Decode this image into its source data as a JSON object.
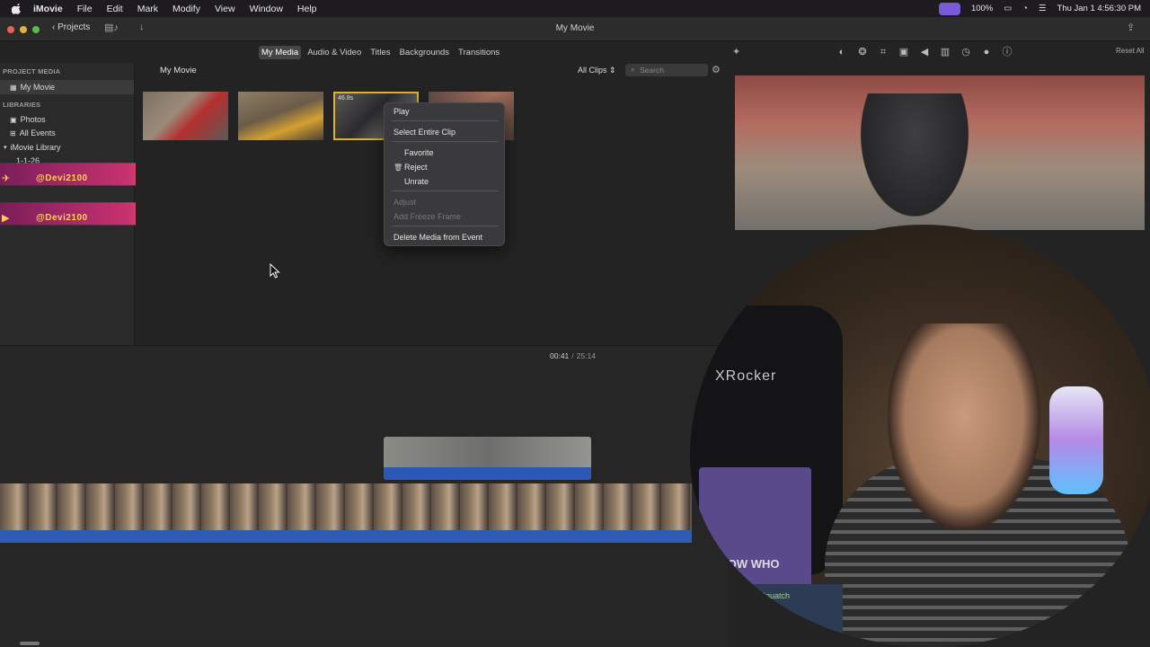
{
  "menubar": {
    "app_name": "iMovie",
    "items": [
      "File",
      "Edit",
      "Mark",
      "Modify",
      "View",
      "Window",
      "Help"
    ],
    "battery": "100%",
    "clock": "Thu Jan 1  4:56:30 PM"
  },
  "toolbar": {
    "projects_label": "Projects",
    "window_title": "My Movie"
  },
  "tabs": [
    "My Media",
    "Audio & Video",
    "Titles",
    "Backgrounds",
    "Transitions"
  ],
  "inspector": {
    "reset_all": "Reset All"
  },
  "sidebar": {
    "project_media_header": "PROJECT MEDIA",
    "project_item": "My Movie",
    "libraries_header": "LIBRARIES",
    "photos": "Photos",
    "all_events": "All Events",
    "library_name": "iMovie Library",
    "event_name": "1-1-26"
  },
  "browser": {
    "title": "My Movie",
    "filter": "All Clips",
    "search_placeholder": "Search",
    "selected_clip_duration": "46.8s"
  },
  "overlays": {
    "banner1_text": "@Devi2100",
    "banner2_text": "@Devi2100"
  },
  "context_menu": {
    "play": "Play",
    "select_entire_clip": "Select Entire Clip",
    "favorite": "Favorite",
    "reject": "Reject",
    "unrate": "Unrate",
    "adjust": "Adjust",
    "add_freeze_frame": "Add Freeze Frame",
    "delete_media": "Delete Media from Event"
  },
  "timeline": {
    "current_time": "00:41",
    "separator": "/",
    "total_time": "25:14"
  },
  "webcam": {
    "chair_brand": "XRocker",
    "box_text": "U KNOW WHO",
    "box2_text": "Squatch"
  }
}
